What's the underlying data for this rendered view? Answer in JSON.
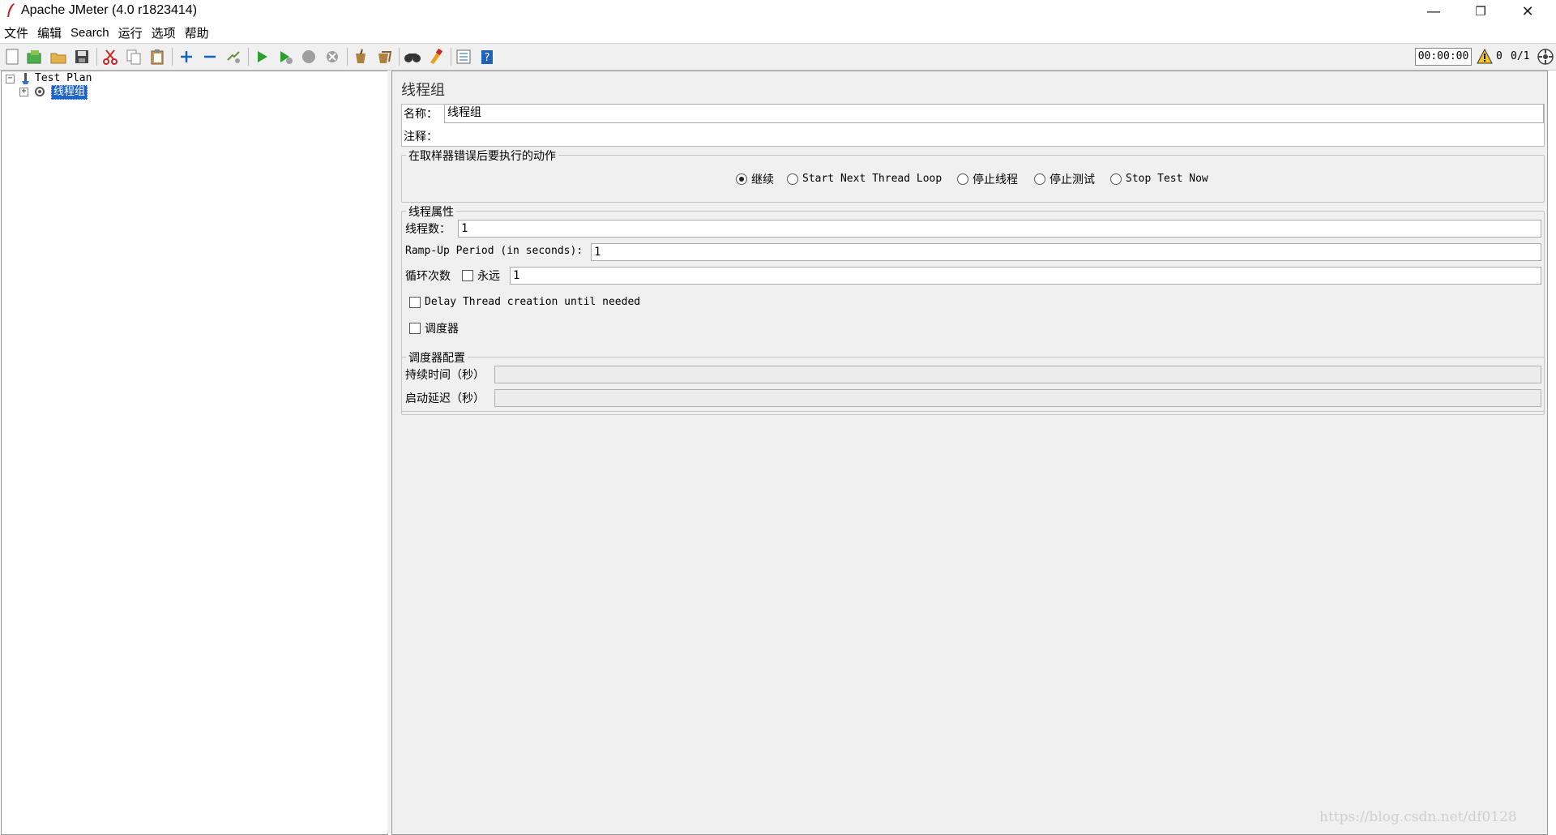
{
  "window": {
    "title": "Apache JMeter (4.0 r1823414)",
    "controls": {
      "minimize": "—",
      "restore": "❐",
      "close": "✕"
    }
  },
  "menu": [
    "文件",
    "编辑",
    "Search",
    "运行",
    "选项",
    "帮助"
  ],
  "toolbar": {
    "icons": [
      "new-icon",
      "templates-icon",
      "open-icon",
      "save-icon",
      "cut-icon",
      "copy-icon",
      "paste-icon",
      "expand-icon",
      "collapse-icon",
      "toggle-icon",
      "start-icon",
      "start-no-pauses-icon",
      "stop-icon",
      "shutdown-icon",
      "clear-icon",
      "clear-all-icon",
      "search-icon",
      "reset-search-icon",
      "function-helper-icon",
      "help-icon"
    ],
    "timer": "00:00:00",
    "warning_count": "0",
    "thread_count": "0/1"
  },
  "tree": {
    "root": "Test Plan",
    "child": "线程组"
  },
  "panel": {
    "title": "线程组",
    "name_label": "名称：",
    "name_value": "线程组",
    "comment_label": "注释：",
    "comment_value": "",
    "sampler_error": {
      "title": "在取样器错误后要执行的动作",
      "options": [
        "继续",
        "Start Next Thread Loop",
        "停止线程",
        "停止测试",
        "Stop Test Now"
      ],
      "selected": "继续"
    },
    "thread_props": {
      "title": "线程属性",
      "threads_label": "线程数：",
      "threads_value": "1",
      "rampup_label": "Ramp-Up Period (in seconds):",
      "rampup_value": "1",
      "loop_label": "循环次数",
      "forever_label": "永远",
      "loop_value": "1",
      "delay_label": "Delay Thread creation until needed",
      "scheduler_label": "调度器"
    },
    "scheduler_config": {
      "title": "调度器配置",
      "duration_label": "持续时间（秒）",
      "duration_value": "",
      "delay_label": "启动延迟（秒）",
      "delay_value": ""
    }
  },
  "watermark": "https://blog.csdn.net/df0128"
}
